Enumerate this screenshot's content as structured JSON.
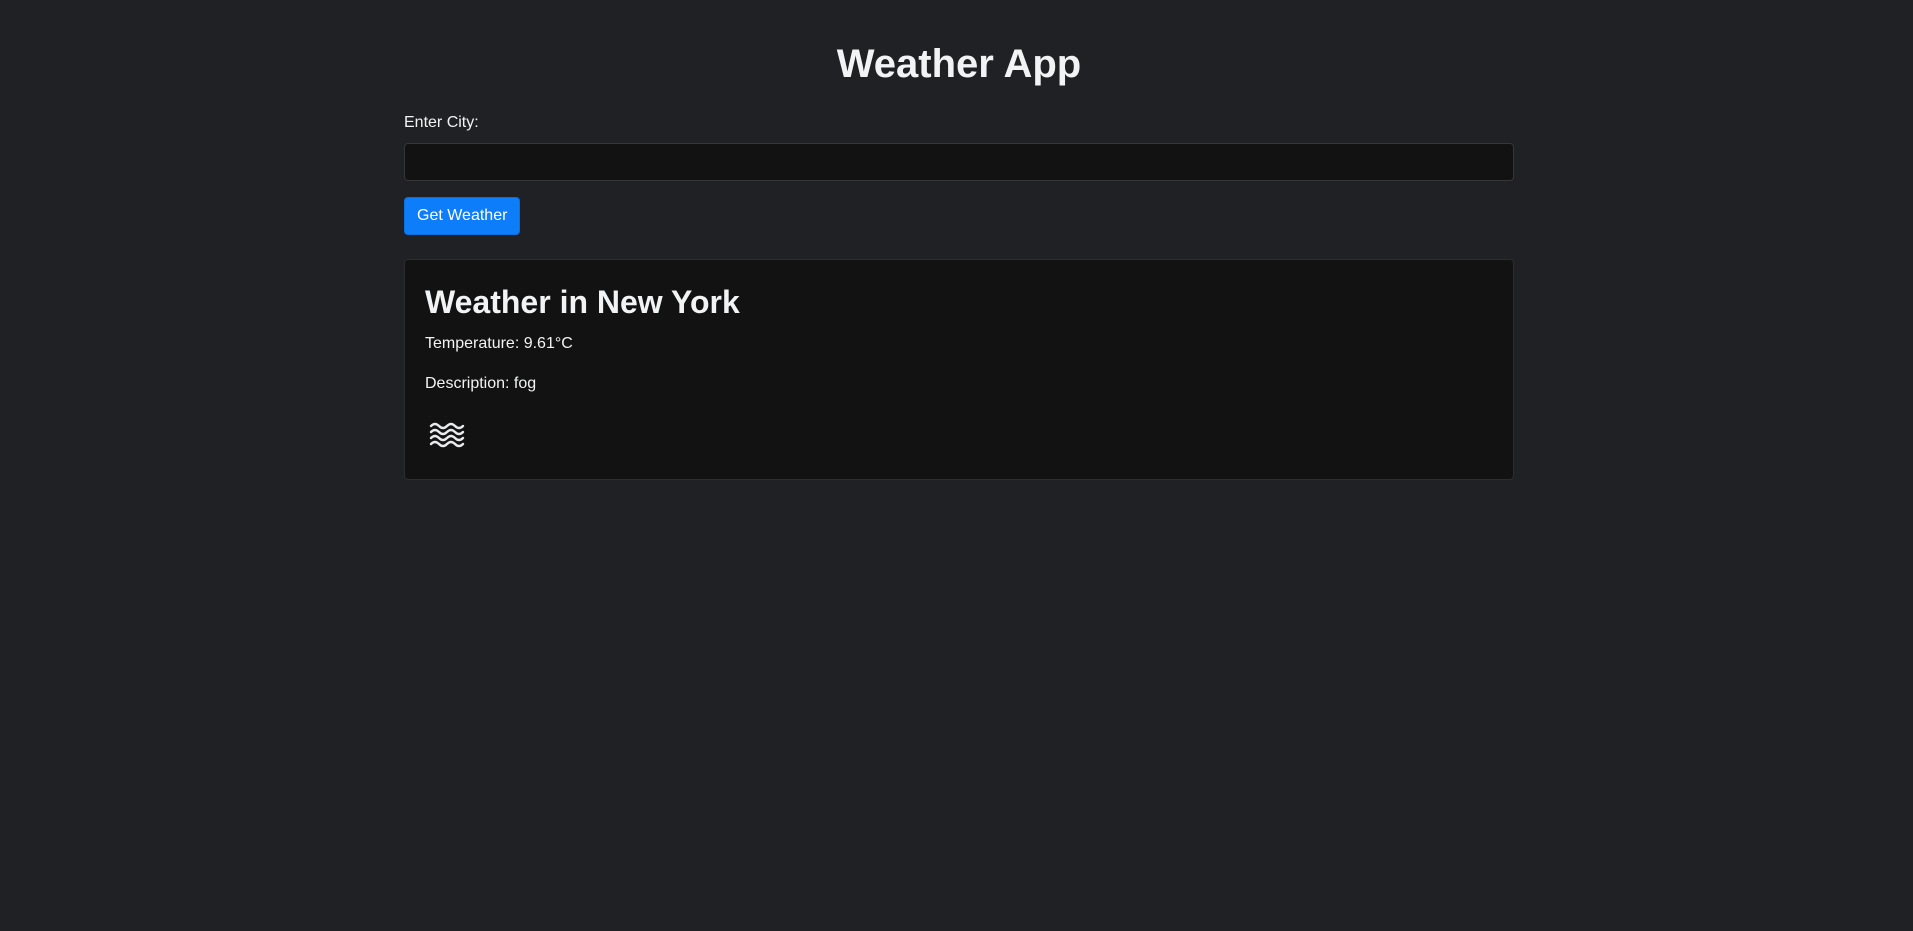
{
  "app": {
    "title": "Weather App"
  },
  "form": {
    "city_label": "Enter City:",
    "city_value": "",
    "city_placeholder": "",
    "submit_label": "Get Weather"
  },
  "result": {
    "heading": "Weather in New York",
    "temperature_text": "Temperature: 9.61°C",
    "description_text": "Description: fog",
    "icon": "fog-icon"
  },
  "colors": {
    "background": "#202124",
    "card": "#121212",
    "accent": "#0d7df9"
  }
}
